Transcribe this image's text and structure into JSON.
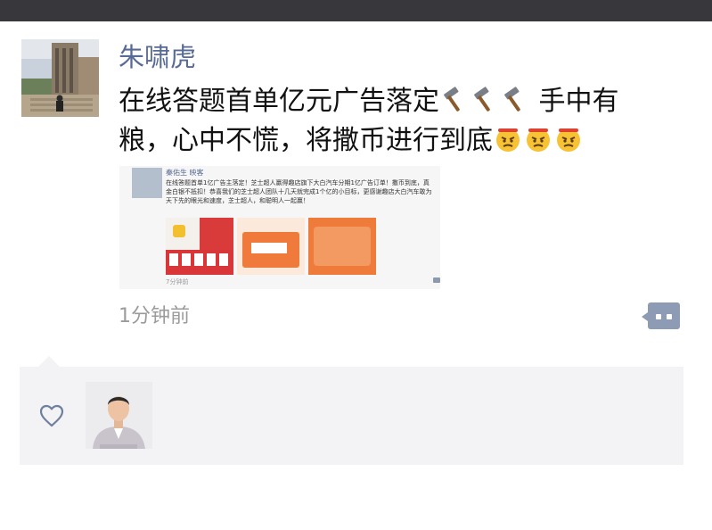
{
  "post": {
    "username": "朱啸虎",
    "text_line1": "在线答题首单亿元广告落定",
    "text_line1_emojis": [
      "hammer-emoji",
      "hammer-emoji",
      "hammer-emoji"
    ],
    "text_line1_tail": " 手中有",
    "text_line2": "粮，心中不慌，将撒币进行到底",
    "text_line2_emojis": [
      "angry-face-emoji",
      "angry-face-emoji",
      "angry-face-emoji"
    ],
    "time": "1分钟前"
  },
  "shared": {
    "name": "秦佑生 映客",
    "text": "在线答题首单1亿广告主落定！芝士超人赢得趣店旗下大白汽车分期1亿广告订单！撒币到底，真金白银不抵扣！恭喜我们的芝士超人团队十几天就完成1个亿的小目标，更感谢趣店大白汽车敢为天下先的眼光和速度，芝士超人，和聪明人一起赢！",
    "time": "7分钟前"
  },
  "likes": {
    "icon": "heart-icon"
  },
  "colors": {
    "name": "#586b95",
    "time": "#9b9b9b",
    "comment_button": "#8d9cb4",
    "likes_bg": "#f3f3f5",
    "topbar": "#38383c"
  }
}
